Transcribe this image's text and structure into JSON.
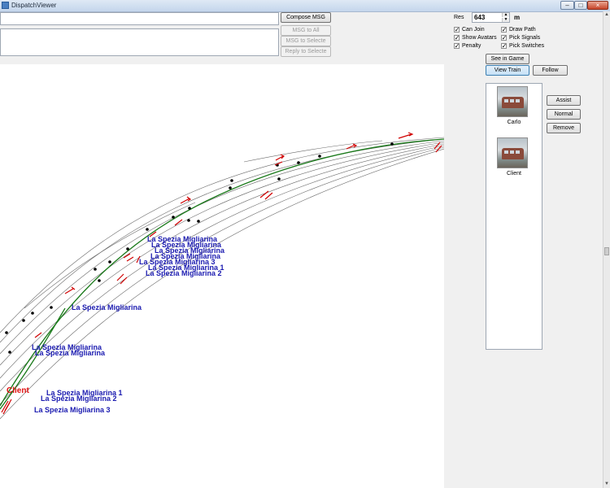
{
  "window": {
    "title": "DispatchViewer",
    "minimize": "–",
    "maximize": "□",
    "close": "×"
  },
  "messages": {
    "compose": "Compose MSG",
    "to_all": "MSG to All",
    "to_selected": "MSG to Selecte",
    "reply_selected": "Reply to Selecte"
  },
  "settings": {
    "res_label": "Res",
    "res_value": "643",
    "res_unit": "m",
    "options": [
      {
        "label": "Can Join",
        "checked": true
      },
      {
        "label": "Show Avatars",
        "checked": true
      },
      {
        "label": "Penalty",
        "checked": true
      },
      {
        "label": "Draw Path",
        "checked": true
      },
      {
        "label": "Pick Signals",
        "checked": true
      },
      {
        "label": "Pick Switches",
        "checked": true
      }
    ],
    "check_mark": "✓"
  },
  "view": {
    "see_in_game": "See in Game",
    "view_train": "View Train",
    "follow": "Follow"
  },
  "players": [
    {
      "name": "Carlo"
    },
    {
      "name": "Client"
    }
  ],
  "player_actions": {
    "assist": "Assist",
    "normal": "Normal",
    "remove": "Remove"
  },
  "map": {
    "station_labels": [
      "La Spezia Migliarina",
      "La Spezia Migliarina",
      "La Spezia Migliarina",
      "La Spezia Migliarina",
      "La Spezia Migliarina 3",
      "La Spezia Migliarina 1",
      "La Spezia Migliarina 2",
      "La Spezia Migliarina",
      "La Spezia Migliarina",
      "La Spezia Migliarina",
      "La Spezia Migliarina 1",
      "La Spezia Migliarina 2",
      "La Spezia Migliarina 3"
    ],
    "train_label": "Client",
    "colors": {
      "path": "#1a7a1a",
      "signal": "#d00000",
      "station_label": "#1a1ab0",
      "train_label": "#e01010"
    }
  },
  "scrollbar": {
    "up": "▲",
    "down": "▼"
  }
}
